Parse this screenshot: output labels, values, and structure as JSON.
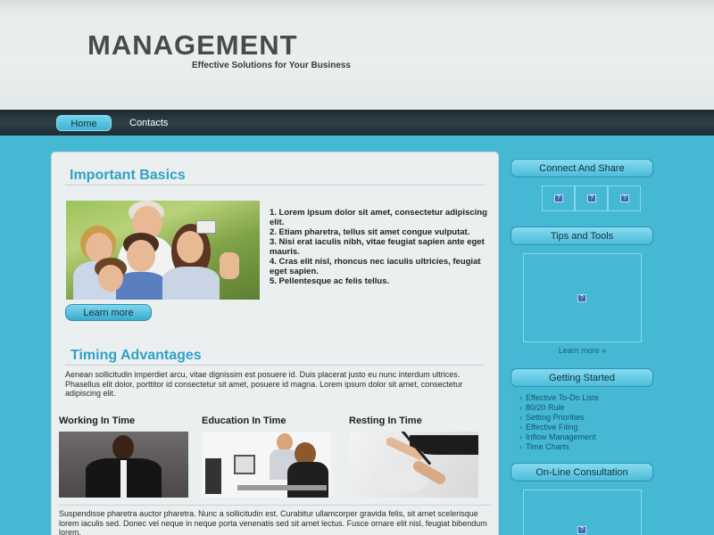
{
  "header": {
    "logo": "MANAGEMENT",
    "slogan": "Effective Solutions for Your Business"
  },
  "nav": {
    "items": [
      {
        "label": "Home",
        "active": true
      },
      {
        "label": "Contacts",
        "active": false
      }
    ]
  },
  "main": {
    "basics": {
      "title": "Important Basics",
      "list": [
        "1. Lorem ipsum dolor sit amet, consectetur adipiscing elit.",
        "2. Etiam pharetra, tellus sit amet congue vulputat.",
        "3. Nisi erat iaculis nibh, vitae feugiat sapien ante eget mauris.",
        "4. Cras elit nisl, rhoncus nec iaculis ultricies, feugiat eget sapien.",
        "5. Pellentesque ac felis tellus."
      ],
      "button": "Learn more"
    },
    "timing": {
      "title": "Timing Advantages",
      "text": "Aenean sollicitudin imperdiet arcu, vitae dignissim est posuere id. Duis placerat justo eu nunc interdum ultrices. Phasellus elit dolor, porttitor id consectetur sit amet, posuere id magna. Lorem ipsum dolor sit amet, consectetur adipiscing elit."
    },
    "columns": [
      {
        "title": "Working In Time"
      },
      {
        "title": "Education In Time"
      },
      {
        "title": "Resting In Time"
      }
    ],
    "bottom_text": "Suspendisse pharetra auctor pharetra. Nunc a sollicitudin est. Curabitur ullamcorper gravida felis, sit amet scelerisque lorem iaculis sed. Donec vel neque in neque porta venenatis sed sit amet lectus. Fusce ornare elit nisl, feugiat bibendum lorem."
  },
  "sidebar": {
    "connect": {
      "title": "Connect And Share",
      "icons": [
        "share-icon",
        "share-icon",
        "share-icon"
      ]
    },
    "tips": {
      "title": "Tips and Tools",
      "link": "Learn more »"
    },
    "started": {
      "title": "Getting Started",
      "items": [
        "Effective To-Do Lists",
        "80/20 Rule",
        "Setting Priorities",
        "Effective Filing",
        "Inflow Management",
        "Time Charts"
      ]
    },
    "consult": {
      "title": "On-Line Consultation"
    }
  },
  "colors": {
    "background": "#45b9d3",
    "accent": "#2ea2c6",
    "nav_bar": "#1f2d33"
  }
}
